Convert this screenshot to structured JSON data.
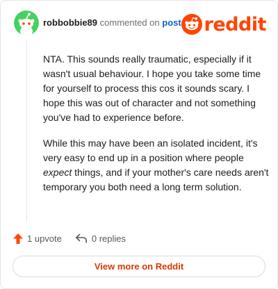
{
  "header": {
    "username": "robbobbie89",
    "action_text": "commented on",
    "post_link": "post",
    "logo_text": "reddit"
  },
  "comment": {
    "paragraph1": "NTA. This sounds really traumatic, especially if it wasn't usual behaviour. I hope you take some time for yourself to process this cos it sounds scary. I hope this was out of character and not something you've had to experience before.",
    "paragraph2_before": "While this may have been an isolated incident, it's very easy to end up in a position where people ",
    "paragraph2_emphasis": "expect",
    "paragraph2_after": " things, and if your mother's care needs aren't temporary you both need a long term solution."
  },
  "actions": {
    "upvotes": "1 upvote",
    "replies": "0 replies"
  },
  "footer": {
    "view_more": "View more on Reddit"
  },
  "colors": {
    "brand": "#ff4500",
    "avatar_bg": "#46d160",
    "link": "#0a63c5",
    "button_text": "#d93900"
  },
  "icons": {
    "avatar": "snoo-avatar-icon",
    "logo": "reddit-snoo-icon",
    "upvote": "upvote-arrow-icon",
    "reply": "reply-arrow-icon"
  }
}
